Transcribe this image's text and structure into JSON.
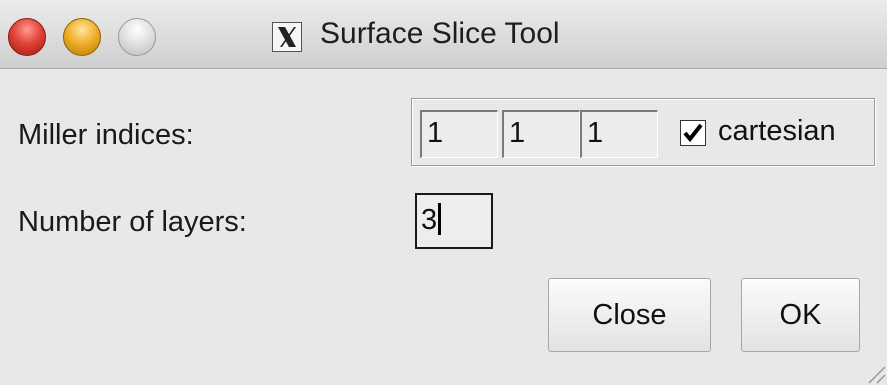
{
  "window": {
    "title": "Surface Slice Tool",
    "controls": [
      "close-icon",
      "minimize-icon",
      "zoom-icon"
    ],
    "app_icon": "x11-icon"
  },
  "miller": {
    "label": "Miller indices:",
    "h": "1",
    "k": "1",
    "l": "1",
    "cartesian_label": "cartesian",
    "cartesian_checked": true
  },
  "layers": {
    "label": "Number of layers:",
    "value": "3"
  },
  "buttons": {
    "close": "Close",
    "ok": "OK"
  },
  "colors": {
    "window_bg": "#e8e8e8",
    "close_light": "#e0443a",
    "minimize_light": "#f0b02c",
    "zoom_light": "#dedede"
  }
}
